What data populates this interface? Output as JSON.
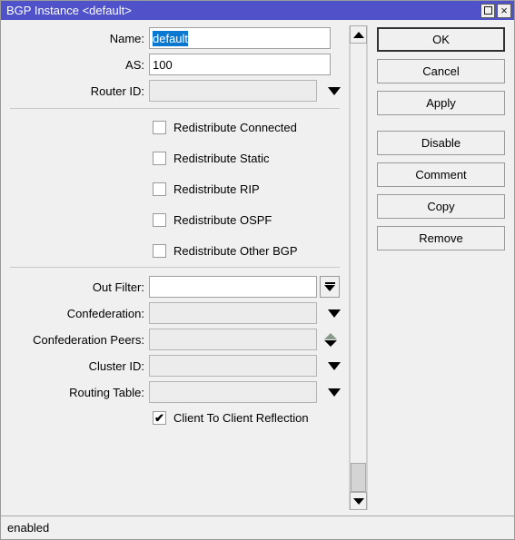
{
  "window": {
    "title": "BGP Instance <default>",
    "titlebar_color": "#4f52c8",
    "background_color": "#f0f0f0",
    "selection_color": "#0a78d0",
    "maximize_icon": "maximize-icon",
    "close_icon": "close-icon",
    "close_glyph": "×"
  },
  "form": {
    "name": {
      "label": "Name:",
      "value": "default",
      "placeholder": "",
      "selected": true
    },
    "as": {
      "label": "AS:",
      "value": "100",
      "placeholder": ""
    },
    "router_id": {
      "label": "Router ID:",
      "value": "",
      "placeholder": "",
      "dropdown_icon": "chevron-down-icon"
    },
    "out_filter": {
      "label": "Out Filter:",
      "value": "",
      "placeholder": "",
      "dropdown_icon": "dropdown-bar-arrow-icon"
    },
    "confederation": {
      "label": "Confederation:",
      "value": "",
      "placeholder": "",
      "dropdown_icon": "chevron-down-icon"
    },
    "confederation_peers": {
      "label": "Confederation Peers:",
      "value": "",
      "placeholder": "",
      "spinner_up_icon": "spinner-up-icon",
      "spinner_down_icon": "spinner-down-icon"
    },
    "cluster_id": {
      "label": "Cluster ID:",
      "value": "",
      "placeholder": "",
      "dropdown_icon": "chevron-down-icon"
    },
    "routing_table": {
      "label": "Routing Table:",
      "value": "",
      "placeholder": "",
      "dropdown_icon": "chevron-down-icon"
    }
  },
  "redistribute_checkboxes": [
    {
      "label": "Redistribute Connected",
      "checked": false
    },
    {
      "label": "Redistribute Static",
      "checked": false
    },
    {
      "label": "Redistribute RIP",
      "checked": false
    },
    {
      "label": "Redistribute OSPF",
      "checked": false
    },
    {
      "label": "Redistribute Other BGP",
      "checked": false
    }
  ],
  "client_reflection": {
    "label": "Client To Client Reflection",
    "checked": true,
    "check_glyph": "✔"
  },
  "buttons": [
    {
      "label": "OK",
      "focused": true
    },
    {
      "label": "Cancel",
      "focused": false
    },
    {
      "label": "Apply",
      "focused": false
    },
    {
      "label": "Disable",
      "focused": false
    },
    {
      "label": "Comment",
      "focused": false
    },
    {
      "label": "Copy",
      "focused": false
    },
    {
      "label": "Remove",
      "focused": false
    }
  ],
  "scrollbar": {
    "up_icon": "scroll-up-arrow-icon",
    "down_icon": "scroll-down-arrow-icon",
    "thumb_position": "bottom"
  },
  "statusbar": {
    "text": "enabled"
  }
}
